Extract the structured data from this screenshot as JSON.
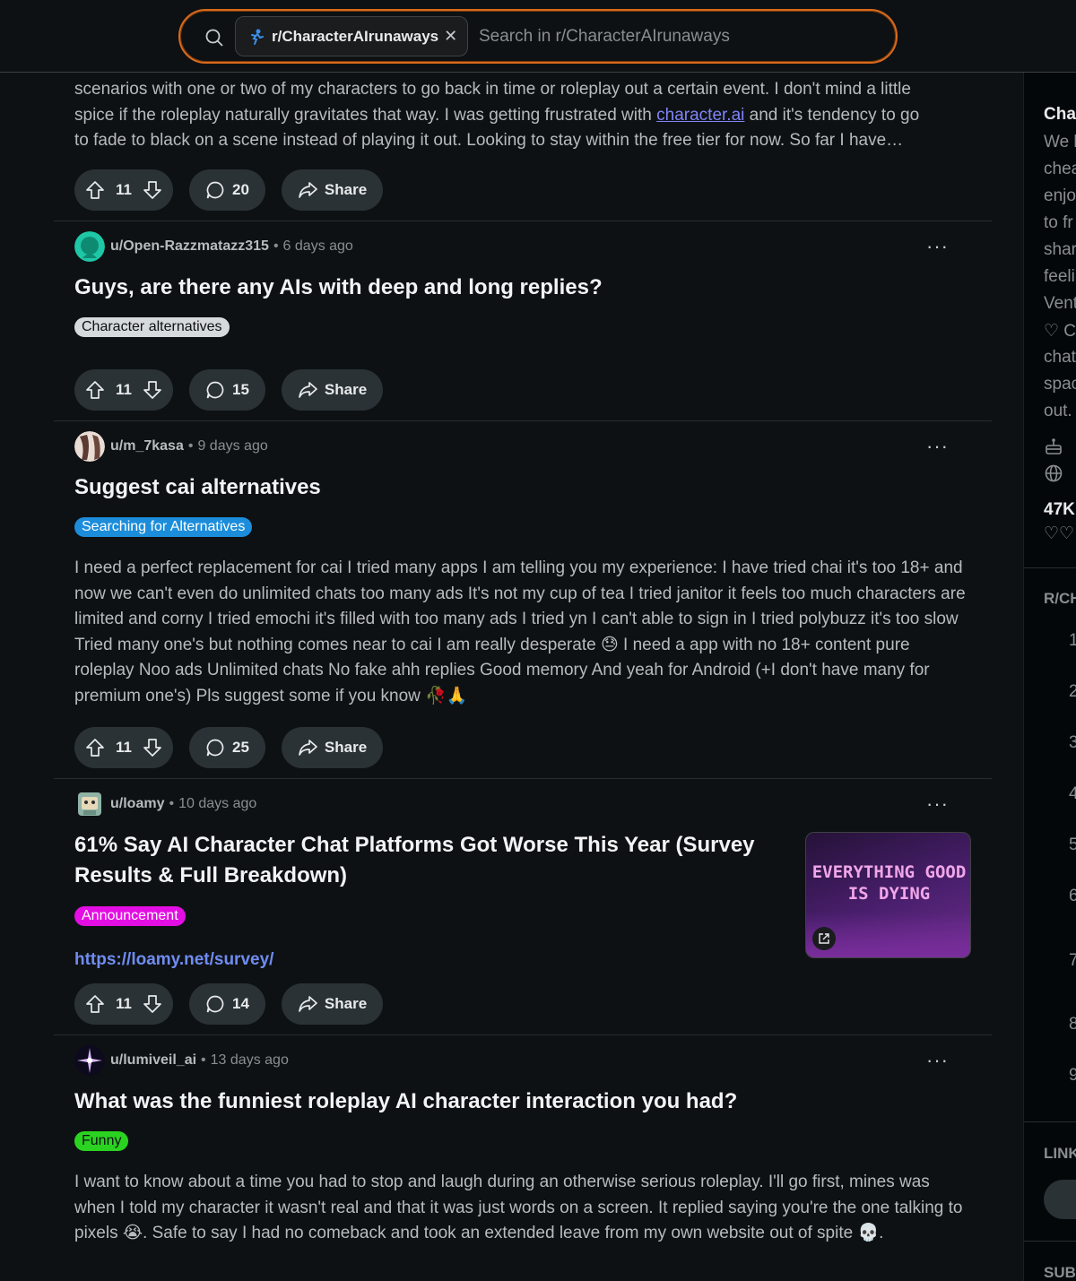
{
  "search": {
    "subreddit_chip": "r/CharacterAIrunaways",
    "placeholder": "Search in r/CharacterAIrunaways",
    "accent": "#d96a1c"
  },
  "posts": [
    {
      "body_partial": {
        "line1": "scenarios with one or two of my characters to go back in time or roleplay out a certain event. I don't mind a little",
        "line2_before": "spice if the roleplay naturally gravitates that way. I was getting frustrated with ",
        "link": "character.ai",
        "line2_after": " and it's tendency to go",
        "line3": "to fade to black on a scene instead of playing it out. Looking to stay within the free tier for now. So far I have…"
      },
      "votes": "11",
      "comments": "20",
      "share": "Share"
    },
    {
      "username": "u/Open-Razzmatazz315",
      "time": "6 days ago",
      "title": "Guys, are there any AIs with deep and long replies?",
      "flair": "Character alternatives",
      "flair_bg": "#d7dadc",
      "flair_fg": "#0e1113",
      "votes": "11",
      "comments": "15",
      "share": "Share"
    },
    {
      "username": "u/m_7kasa",
      "time": "9 days ago",
      "title": "Suggest cai alternatives",
      "flair": "Searching for Alternatives",
      "flair_bg": "#1c8ddb",
      "flair_fg": "#ffffff",
      "body": "I need a perfect replacement for cai I tried many apps I am telling you my experience: I have tried chai it's too 18+ and now we can't even do unlimited chats too many ads It's not my cup of tea I tried janitor it feels too much characters are limited and corny I tried emochi it's filled with too many ads I tried yn I can't able to sign in I tried polybuzz it's too slow Tried many one's but nothing comes near to cai I am really desperate 😓 I need a app with no 18+ content pure roleplay Noo ads Unlimited chats No fake ahh replies Good memory And yeah for Android (+I don't have many for premium one's) Pls suggest some if you know 🥀🙏",
      "votes": "11",
      "comments": "25",
      "share": "Share"
    },
    {
      "username": "u/loamy",
      "time": "10 days ago",
      "title": "61% Say AI Character Chat Platforms Got Worse This Year (Survey Results & Full Breakdown)",
      "flair": "Announcement",
      "flair_bg": "#e30ee3",
      "flair_fg": "#ffffff",
      "url": "https://loamy.net/survey/",
      "thumbnail_text": "EVERYTHING GOOD IS DYING",
      "votes": "11",
      "comments": "14",
      "share": "Share"
    },
    {
      "username": "u/lumiveil_ai",
      "time": "13 days ago",
      "title": "What was the funniest roleplay AI character interaction you had?",
      "flair": "Funny",
      "flair_bg": "#2bd321",
      "flair_fg": "#0e1113",
      "body": "I want to know about a time you had to stop and laugh during an otherwise serious roleplay. I'll go first, mines was when I told my character it wasn't real and that it was just words on a screen. It replied saying you're the one talking to pixels 😭. Safe to say I had no comeback and took an extended leave from my own website out of spite 💀."
    }
  ],
  "sidebar": {
    "title": "Cha",
    "lines": [
      "We l",
      "chea",
      "enjo",
      "to fr",
      "shar",
      "feeli",
      "Vent",
      "♡ C",
      "chat",
      "spac",
      "out."
    ],
    "member_count": "47K",
    "hearts": "♡♡",
    "rules_heading": "R/CH",
    "rule_numbers": [
      "1",
      "2",
      "3",
      "4",
      "5",
      "6",
      "7",
      "8",
      "9"
    ],
    "links_heading": "LINK",
    "sub_heading": "SUB"
  }
}
